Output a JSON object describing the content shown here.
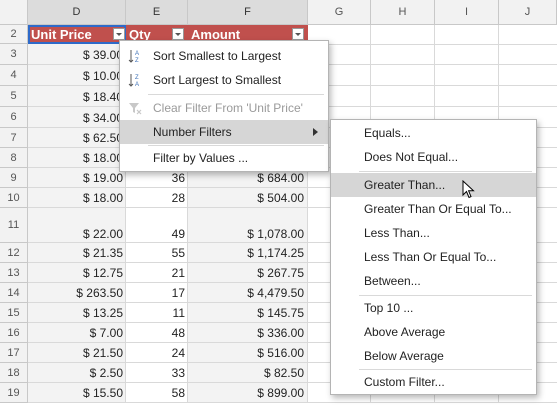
{
  "columns": [
    "D",
    "E",
    "F",
    "G",
    "H",
    "I",
    "J"
  ],
  "rows": [
    "2",
    "3",
    "4",
    "5",
    "6",
    "7",
    "8",
    "9",
    "10",
    "11",
    "12",
    "13",
    "14",
    "15",
    "16",
    "17",
    "18",
    "19"
  ],
  "table_headers": {
    "unit_price": "Unit Price",
    "qty": "Qty",
    "amount": "Amount"
  },
  "data_rows": [
    {
      "price": "$ 39.00",
      "qty": "",
      "amount": ""
    },
    {
      "price": "$ 10.00",
      "qty": "",
      "amount": ""
    },
    {
      "price": "$ 18.40",
      "qty": "",
      "amount": ""
    },
    {
      "price": "$ 34.00",
      "qty": "",
      "amount": ""
    },
    {
      "price": "$ 62.50",
      "qty": "",
      "amount": ""
    },
    {
      "price": "$ 18.00",
      "qty": "",
      "amount": ""
    },
    {
      "price": "$ 19.00",
      "qty": "36",
      "amount": "$ 684.00"
    },
    {
      "price": "$ 18.00",
      "qty": "28",
      "amount": "$ 504.00"
    },
    {
      "price": "$ 22.00",
      "qty": "49",
      "amount": "$ 1,078.00"
    },
    {
      "price": "$ 21.35",
      "qty": "55",
      "amount": "$ 1,174.25"
    },
    {
      "price": "$ 12.75",
      "qty": "21",
      "amount": "$ 267.75"
    },
    {
      "price": "$ 263.50",
      "qty": "17",
      "amount": "$ 4,479.50"
    },
    {
      "price": "$ 13.25",
      "qty": "11",
      "amount": "$ 145.75"
    },
    {
      "price": "$ 7.00",
      "qty": "48",
      "amount": "$ 336.00"
    },
    {
      "price": "$ 21.50",
      "qty": "24",
      "amount": "$ 516.00"
    },
    {
      "price": "$ 2.50",
      "qty": "33",
      "amount": "$ 82.50"
    },
    {
      "price": "$ 15.50",
      "qty": "58",
      "amount": "$ 899.00"
    }
  ],
  "filter_menu": {
    "sort_asc": "Sort Smallest to Largest",
    "sort_desc": "Sort Largest to Smallest",
    "clear_filter": "Clear Filter From 'Unit Price'",
    "number_filters": "Number Filters",
    "filter_by_values": "Filter by Values ..."
  },
  "number_filters_menu": {
    "equals": "Equals...",
    "not_equal": "Does Not Equal...",
    "greater_than": "Greater Than...",
    "greater_equal": "Greater Than Or Equal To...",
    "less_than": "Less Than...",
    "less_equal": "Less Than Or Equal To...",
    "between": "Between...",
    "top10": "Top 10 ...",
    "above_avg": "Above Average",
    "below_avg": "Below Average",
    "custom": "Custom Filter..."
  },
  "colors": {
    "header_red": "#c0504d",
    "highlight": "#d6d6d6"
  },
  "icons": [
    "sort-ascending-icon",
    "sort-descending-icon",
    "clear-filter-icon",
    "submenu-arrow-icon",
    "mouse-cursor-icon"
  ]
}
